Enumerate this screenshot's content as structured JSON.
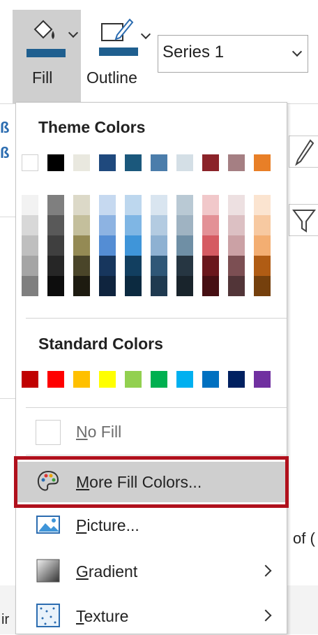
{
  "toolbar": {
    "fill_label": "Fill",
    "outline_label": "Outline",
    "series_value": "Series 1",
    "fill_bar_color": "#1f5f8f",
    "outline_bar_color": "#1f5f8f"
  },
  "panel": {
    "theme_title": "Theme Colors",
    "standard_title": "Standard Colors",
    "theme_base": [
      "#ffffff",
      "#000000",
      "#e9e8df",
      "#1f497d",
      "#1b587c",
      "#4b7dab",
      "#d4dfe6",
      "#8b2329",
      "#a57f83",
      "#e87f27"
    ],
    "theme_shades": [
      [
        "#f2f2f2",
        "#d8d8d8",
        "#bfbfbf",
        "#a5a5a5",
        "#7f7f7f"
      ],
      [
        "#7f7f7f",
        "#595959",
        "#3f3f3f",
        "#262626",
        "#0d0d0d"
      ],
      [
        "#dcd9c8",
        "#c4bf9c",
        "#948a54",
        "#4a4529",
        "#1d1b10"
      ],
      [
        "#c6d9f0",
        "#8db3e2",
        "#548dd4",
        "#17365d",
        "#0f243e"
      ],
      [
        "#bdd7ee",
        "#7fb6e4",
        "#3f95d9",
        "#123f60",
        "#0c2a40"
      ],
      [
        "#d9e5f0",
        "#b3cbe1",
        "#8eb1d2",
        "#2f5777",
        "#1f3a50"
      ],
      [
        "#b9c9d4",
        "#9fb3c2",
        "#6f8fa5",
        "#263642",
        "#19242c"
      ],
      [
        "#f1c8ca",
        "#e39196",
        "#d55b62",
        "#6a171c",
        "#460f13"
      ],
      [
        "#ede0e1",
        "#dcc0c3",
        "#cba1a5",
        "#7c4f53",
        "#523538"
      ],
      [
        "#fbe4d0",
        "#f7c9a1",
        "#f3ae72",
        "#b05c14",
        "#75400d"
      ]
    ],
    "standard": [
      "#c00000",
      "#ff0000",
      "#ffc000",
      "#ffff00",
      "#92d050",
      "#00b050",
      "#00b0f0",
      "#0070c0",
      "#002060",
      "#7030a0"
    ],
    "items": {
      "no_fill_pre": "",
      "no_fill_key": "N",
      "no_fill_post": "o Fill",
      "more_key": "M",
      "more_post": "ore Fill Colors...",
      "picture_key": "P",
      "picture_post": "icture...",
      "gradient_key": "G",
      "gradient_post": "radient",
      "texture_key": "T",
      "texture_post": "exture"
    }
  },
  "background": {
    "right_text": "of (",
    "left_text": "ir"
  }
}
